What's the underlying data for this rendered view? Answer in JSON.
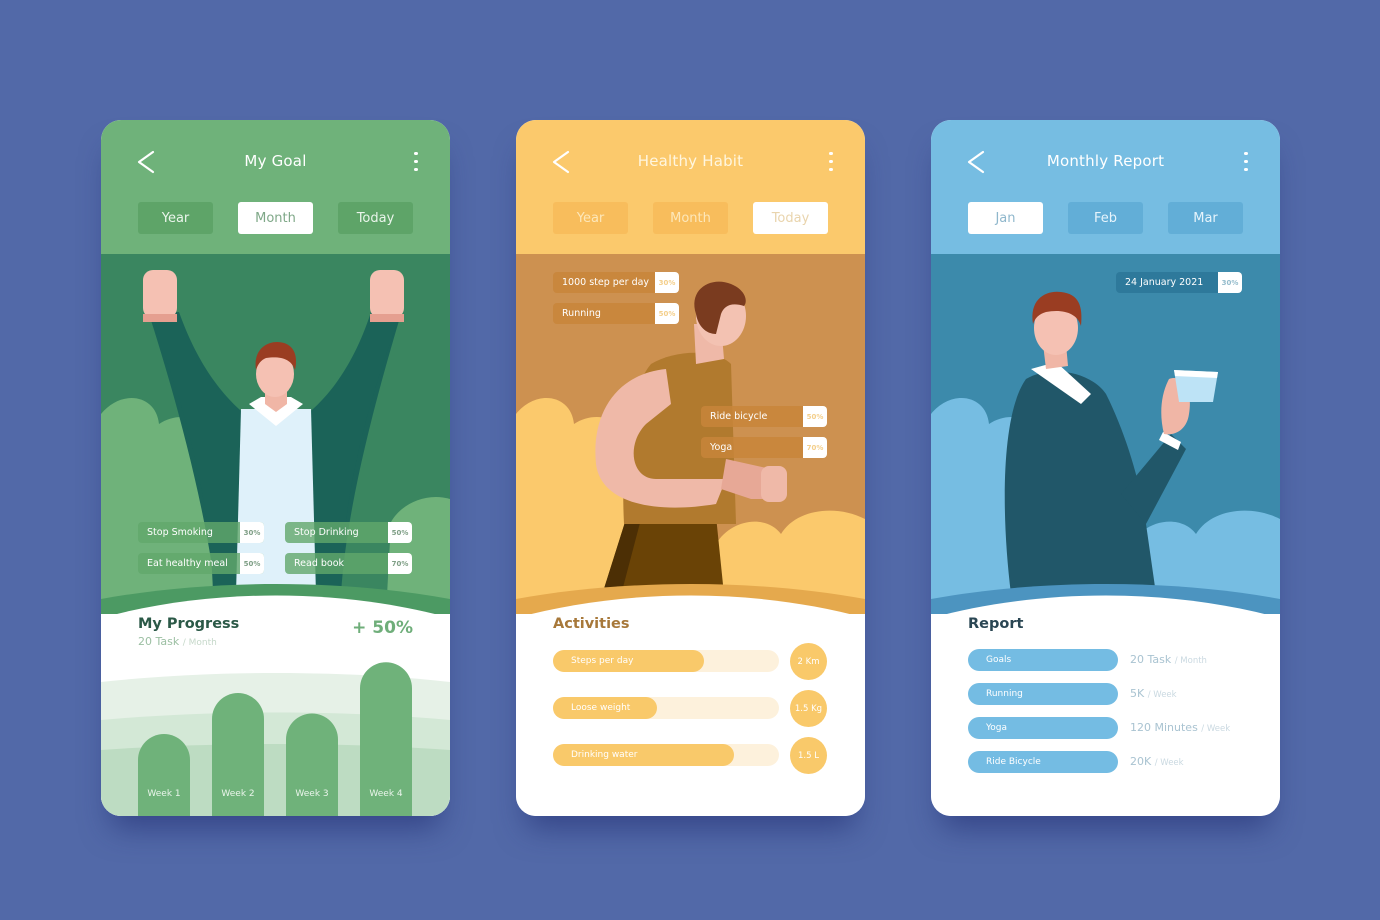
{
  "colors": {
    "background": "#5269a8",
    "goal_accent": "#6fb27a",
    "habit_accent": "#fbc96c",
    "report_accent": "#76bde2"
  },
  "goal": {
    "title": "My Goal",
    "back_icon": "chevron-left-icon",
    "menu_icon": "more-vertical-icon",
    "tabs": [
      {
        "label": "Year",
        "active": false
      },
      {
        "label": "Month",
        "active": true
      },
      {
        "label": "Today",
        "active": false
      }
    ],
    "chips": [
      {
        "label": "Stop Smoking",
        "value": "30%"
      },
      {
        "label": "Stop Drinking",
        "value": "50%"
      },
      {
        "label": "Eat healthy meal",
        "value": "50%"
      },
      {
        "label": "Read book",
        "value": "70%"
      }
    ],
    "progress": {
      "title": "My Progress",
      "task_count": "20 Task",
      "task_period": "/ Month",
      "change": "+ 50%"
    }
  },
  "habit": {
    "title": "Healthy Habit",
    "back_icon": "chevron-left-icon",
    "menu_icon": "more-vertical-icon",
    "tabs": [
      {
        "label": "Year",
        "active": false
      },
      {
        "label": "Month",
        "active": false
      },
      {
        "label": "Today",
        "active": true
      }
    ],
    "chips": [
      {
        "label": "1000 step per day",
        "value": "30%"
      },
      {
        "label": "Running",
        "value": "50%"
      },
      {
        "label": "Ride bicycle",
        "value": "50%"
      },
      {
        "label": "Yoga",
        "value": "70%"
      }
    ],
    "activities": {
      "title": "Activities",
      "items": [
        {
          "label": "Steps per day",
          "value": "2 Km",
          "progress": 0.67
        },
        {
          "label": "Loose weight",
          "value": "1.5 Kg",
          "progress": 0.46
        },
        {
          "label": "Drinking water",
          "value": "1.5 L",
          "progress": 0.8
        }
      ]
    }
  },
  "report": {
    "title": "Monthly Report",
    "back_icon": "chevron-left-icon",
    "menu_icon": "more-vertical-icon",
    "tabs": [
      {
        "label": "Jan",
        "active": true
      },
      {
        "label": "Feb",
        "active": false
      },
      {
        "label": "Mar",
        "active": false
      }
    ],
    "date_chip": {
      "label": "24 January 2021",
      "value": "30%"
    },
    "section": {
      "title": "Report",
      "items": [
        {
          "label": "Goals",
          "value": "20 Task",
          "unit": "/ Month"
        },
        {
          "label": "Running",
          "value": "5K",
          "unit": "/ Week"
        },
        {
          "label": "Yoga",
          "value": "120 Minutes",
          "unit": "/ Week"
        },
        {
          "label": "Ride Bicycle",
          "value": "20K",
          "unit": "/ Week"
        }
      ]
    }
  },
  "chart_data": {
    "type": "bar",
    "title": "My Progress",
    "categories": [
      "Week 1",
      "Week 2",
      "Week 3",
      "Week 4"
    ],
    "values": [
      40,
      60,
      50,
      75
    ],
    "xlabel": "",
    "ylabel": "",
    "ylim": [
      0,
      80
    ],
    "grid": false,
    "annotation": "+ 50%"
  }
}
